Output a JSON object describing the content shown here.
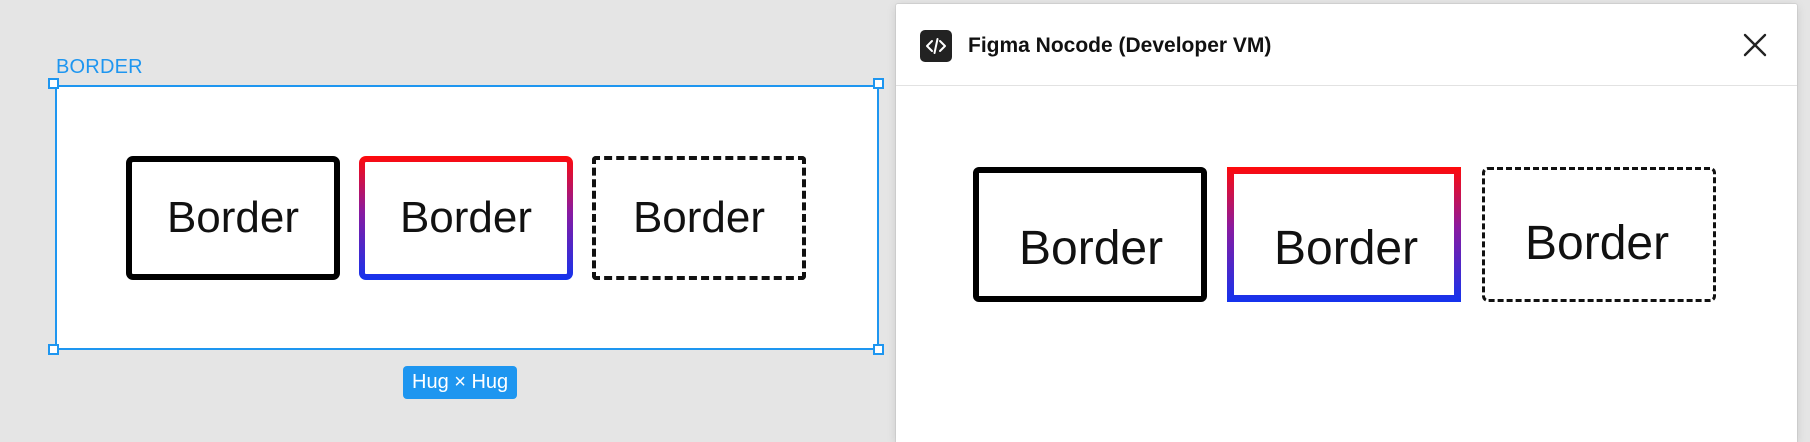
{
  "canvas": {
    "frame_label": "BORDER",
    "size_badge": "Hug × Hug",
    "boxes": [
      {
        "label": "Border",
        "style": "solid",
        "border_color": "#000000"
      },
      {
        "label": "Border",
        "style": "gradient",
        "gradient": [
          "#ff0a0a",
          "#1433ee"
        ]
      },
      {
        "label": "Border",
        "style": "dashed",
        "border_color": "#111111"
      }
    ],
    "selection_color": "#1e96f0"
  },
  "plugin_panel": {
    "title": "Figma Nocode (Developer VM)",
    "icon": "code-icon",
    "close_icon": "close-icon",
    "preview_boxes": [
      {
        "label": "Border",
        "style": "solid"
      },
      {
        "label": "Border",
        "style": "gradient"
      },
      {
        "label": "Border",
        "style": "dashed"
      }
    ]
  }
}
